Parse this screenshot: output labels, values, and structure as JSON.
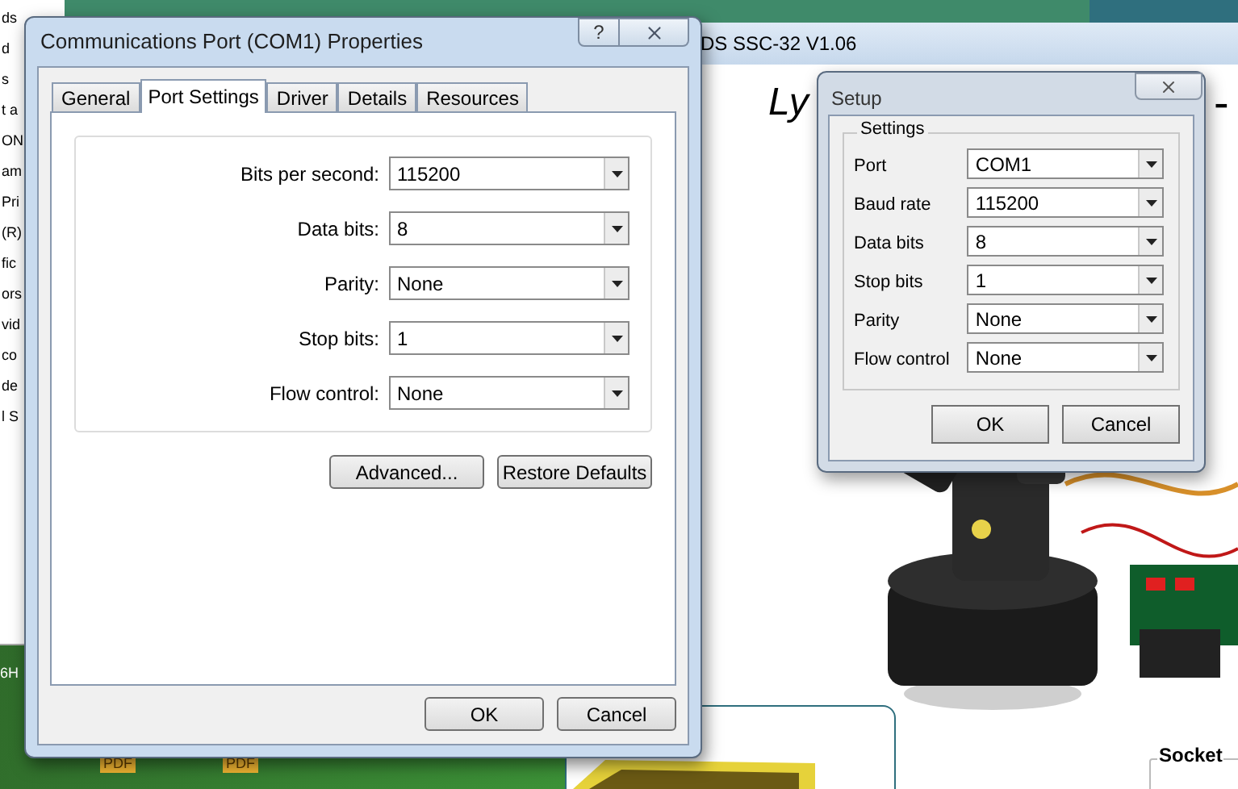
{
  "left_window": {
    "lines": [
      "ds",
      "d",
      "s",
      "t a",
      "ON",
      "am",
      "Pri",
      "(R)",
      "fic",
      "ors",
      "vid",
      "co",
      "de",
      "l S"
    ]
  },
  "desktop": {
    "icon_labels": [
      "6H",
      "PDF",
      "PDF"
    ]
  },
  "app_window": {
    "title": "DS SSC-32 V1.06",
    "heading": "Ly",
    "heading_tail": "-",
    "group_label": "Socket"
  },
  "properties_dialog": {
    "title": "Communications Port (COM1) Properties",
    "help": "?",
    "tabs": [
      {
        "label": "General",
        "selected": false
      },
      {
        "label": "Port Settings",
        "selected": true
      },
      {
        "label": "Driver",
        "selected": false
      },
      {
        "label": "Details",
        "selected": false
      },
      {
        "label": "Resources",
        "selected": false
      }
    ],
    "fields": [
      {
        "label": "Bits per second:",
        "value": "115200"
      },
      {
        "label": "Data bits:",
        "value": "8"
      },
      {
        "label": "Parity:",
        "value": "None"
      },
      {
        "label": "Stop bits:",
        "value": "1"
      },
      {
        "label": "Flow control:",
        "value": "None"
      }
    ],
    "panel_buttons": [
      "Advanced...",
      "Restore Defaults"
    ],
    "buttons": [
      "OK",
      "Cancel"
    ]
  },
  "setup_dialog": {
    "title": "Setup",
    "group": "Settings",
    "fields": [
      {
        "label": "Port",
        "value": "COM1"
      },
      {
        "label": "Baud rate",
        "value": "115200"
      },
      {
        "label": "Data bits",
        "value": "8"
      },
      {
        "label": "Stop bits",
        "value": "1"
      },
      {
        "label": "Parity",
        "value": "None"
      },
      {
        "label": "Flow control",
        "value": "None"
      }
    ],
    "buttons": [
      "OK",
      "Cancel"
    ]
  }
}
